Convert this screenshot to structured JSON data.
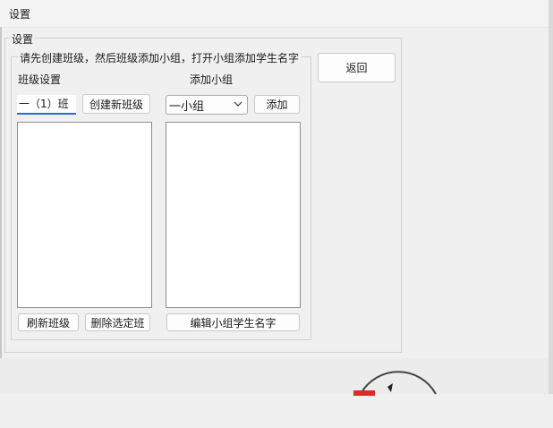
{
  "window": {
    "title": "设置"
  },
  "settings_group": {
    "label": "设置"
  },
  "instruction": "请先创建班级，然后班级添加小组，打开小组添加学生名字",
  "class_section": {
    "heading": "班级设置",
    "class_name_value": "一（1）班",
    "create_button": "创建新班级",
    "refresh_button": "刷新班级",
    "delete_button": "删除选定班"
  },
  "group_section": {
    "heading": "添加小组",
    "group_select_value": "一小组",
    "add_button": "添加",
    "edit_button": "编辑小组学生名字"
  },
  "back_button": "返回",
  "colors": {
    "accent": "#2b6ec8",
    "background": "#f0f0f0"
  },
  "icons": {
    "dropdown": "chevron-down-icon",
    "dial": "dial-graphic"
  }
}
